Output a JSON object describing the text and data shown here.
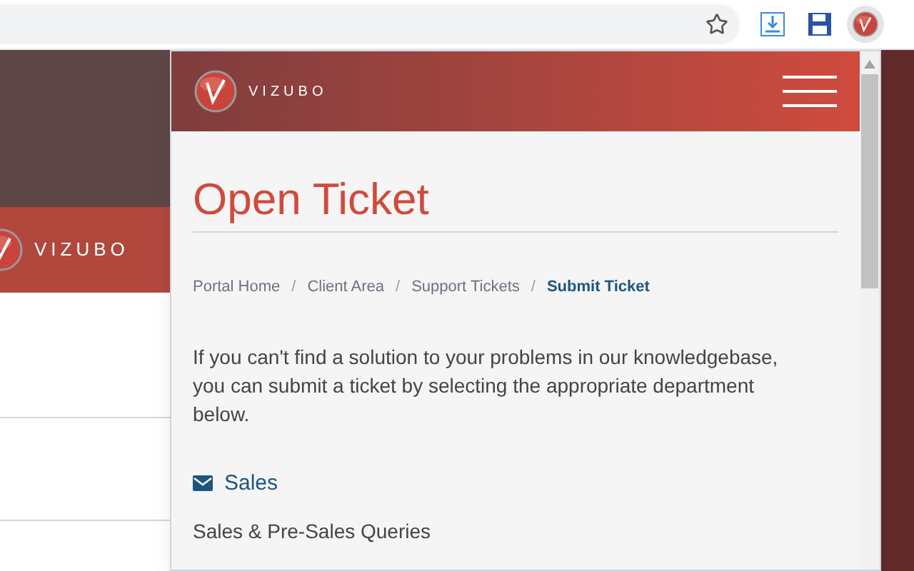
{
  "background_page": {
    "logo_text": "VIZUBO"
  },
  "popup": {
    "header": {
      "logo_text": "VIZUBO"
    },
    "title": "Open Ticket",
    "breadcrumb_separator": "/",
    "breadcrumb": [
      {
        "label": "Portal Home",
        "selected": false
      },
      {
        "label": "Client Area",
        "selected": false
      },
      {
        "label": "Support Tickets",
        "selected": false
      },
      {
        "label": "Submit Ticket",
        "selected": true
      }
    ],
    "intro": "If you can't find a solution to your problems in our knowledgebase, you can submit a ticket by selecting the appropriate department below.",
    "departments": [
      {
        "name": "Sales",
        "description": "Sales & Pre-Sales Queries"
      }
    ]
  }
}
